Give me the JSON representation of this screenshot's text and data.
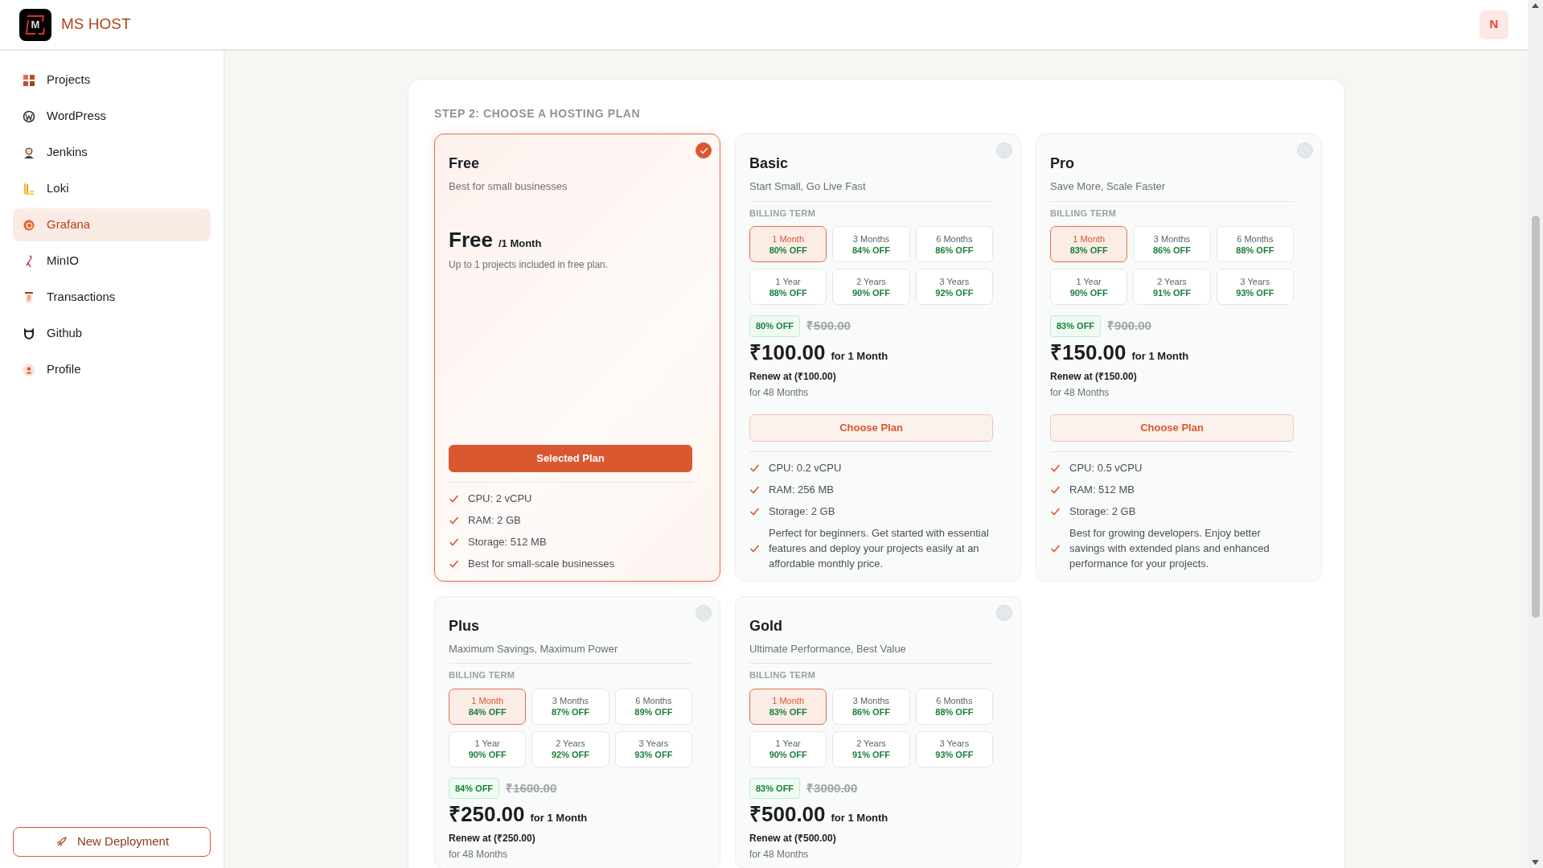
{
  "header": {
    "logo_letter": "M",
    "brand": "MS HOST",
    "avatar": "N"
  },
  "sidebar": {
    "items": [
      {
        "label": "Projects",
        "selected": false
      },
      {
        "label": "WordPress",
        "selected": false
      },
      {
        "label": "Jenkins",
        "selected": false
      },
      {
        "label": "Loki",
        "selected": false
      },
      {
        "label": "Grafana",
        "selected": true
      },
      {
        "label": "MinIO",
        "selected": false
      },
      {
        "label": "Transactions",
        "selected": false
      },
      {
        "label": "Github",
        "selected": false
      },
      {
        "label": "Profile",
        "selected": false
      }
    ],
    "action": "New Deployment"
  },
  "section_title": "STEP 2: CHOOSE A HOSTING PLAN",
  "plans": [
    {
      "kind": "free",
      "name": "Free",
      "tagline": "Best for small businesses",
      "selected": true,
      "price": "Free",
      "price_period": "/1 Month",
      "note": "Up to 1 projects included in free plan.",
      "button": "Selected Plan",
      "features": [
        "CPU: 2 vCPU",
        "RAM: 2 GB",
        "Storage: 512 MB",
        "Best for small-scale businesses"
      ]
    },
    {
      "kind": "paid",
      "name": "Basic",
      "tagline": "Start Small, Go Live Fast",
      "selected": false,
      "billing_label": "BILLING TERM",
      "terms": [
        {
          "term": "1 Month",
          "discount": "80% OFF",
          "selected": true
        },
        {
          "term": "3 Months",
          "discount": "84% OFF",
          "selected": false
        },
        {
          "term": "6 Months",
          "discount": "86% OFF",
          "selected": false
        },
        {
          "term": "1 Year",
          "discount": "88% OFF",
          "selected": false
        },
        {
          "term": "2 Years",
          "discount": "90% OFF",
          "selected": false
        },
        {
          "term": "3 Years",
          "discount": "92% OFF",
          "selected": false
        }
      ],
      "discount_badge": "80% OFF",
      "original_price": "₹500.00",
      "price": "₹100.00",
      "price_period": "for 1 Month",
      "renew": "Renew at (₹100.00)",
      "renew_term": "for 48 Months",
      "button": "Choose Plan",
      "features": [
        "CPU: 0.2 vCPU",
        "RAM: 256 MB",
        "Storage: 2 GB",
        "Perfect for beginners. Get started with essential features and deploy your projects easily at an affordable monthly price."
      ]
    },
    {
      "kind": "paid",
      "name": "Pro",
      "tagline": "Save More, Scale Faster",
      "selected": false,
      "billing_label": "BILLING TERM",
      "terms": [
        {
          "term": "1 Month",
          "discount": "83% OFF",
          "selected": true
        },
        {
          "term": "3 Months",
          "discount": "86% OFF",
          "selected": false
        },
        {
          "term": "6 Months",
          "discount": "88% OFF",
          "selected": false
        },
        {
          "term": "1 Year",
          "discount": "90% OFF",
          "selected": false
        },
        {
          "term": "2 Years",
          "discount": "91% OFF",
          "selected": false
        },
        {
          "term": "3 Years",
          "discount": "93% OFF",
          "selected": false
        }
      ],
      "discount_badge": "83% OFF",
      "original_price": "₹900.00",
      "price": "₹150.00",
      "price_period": "for 1 Month",
      "renew": "Renew at (₹150.00)",
      "renew_term": "for 48 Months",
      "button": "Choose Plan",
      "features": [
        "CPU: 0.5 vCPU",
        "RAM: 512 MB",
        "Storage: 2 GB",
        "Best for growing developers. Enjoy better savings with extended plans and enhanced performance for your projects."
      ]
    },
    {
      "kind": "paid",
      "name": "Plus",
      "tagline": "Maximum Savings, Maximum Power",
      "selected": false,
      "billing_label": "BILLING TERM",
      "terms": [
        {
          "term": "1 Month",
          "discount": "84% OFF",
          "selected": true
        },
        {
          "term": "3 Months",
          "discount": "87% OFF",
          "selected": false
        },
        {
          "term": "6 Months",
          "discount": "89% OFF",
          "selected": false
        },
        {
          "term": "1 Year",
          "discount": "90% OFF",
          "selected": false
        },
        {
          "term": "2 Years",
          "discount": "92% OFF",
          "selected": false
        },
        {
          "term": "3 Years",
          "discount": "93% OFF",
          "selected": false
        }
      ],
      "discount_badge": "84% OFF",
      "original_price": "₹1600.00",
      "price": "₹250.00",
      "price_period": "for 1 Month",
      "renew": "Renew at (₹250.00)",
      "renew_term": "for 48 Months"
    },
    {
      "kind": "paid",
      "name": "Gold",
      "tagline": "Ultimate Performance, Best Value",
      "selected": false,
      "billing_label": "BILLING TERM",
      "terms": [
        {
          "term": "1 Month",
          "discount": "83% OFF",
          "selected": true
        },
        {
          "term": "3 Months",
          "discount": "86% OFF",
          "selected": false
        },
        {
          "term": "6 Months",
          "discount": "88% OFF",
          "selected": false
        },
        {
          "term": "1 Year",
          "discount": "90% OFF",
          "selected": false
        },
        {
          "term": "2 Years",
          "discount": "91% OFF",
          "selected": false
        },
        {
          "term": "3 Years",
          "discount": "93% OFF",
          "selected": false
        }
      ],
      "discount_badge": "83% OFF",
      "original_price": "₹3000.00",
      "price": "₹500.00",
      "price_period": "for 1 Month",
      "renew": "Renew at (₹500.00)",
      "renew_term": "for 48 Months"
    }
  ]
}
